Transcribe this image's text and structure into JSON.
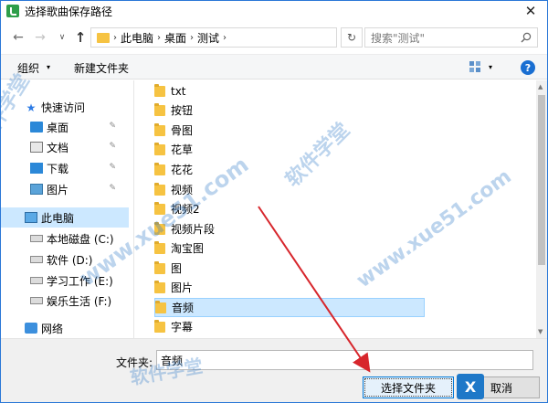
{
  "window": {
    "title": "选择歌曲保存路径",
    "close_glyph": "✕"
  },
  "nav": {
    "back": "←",
    "forward": "→",
    "recent": "∨",
    "up": "↑",
    "breadcrumbs": [
      "此电脑",
      "桌面",
      "测试"
    ],
    "dropdown": "∨",
    "refresh": "↻",
    "search_placeholder": "搜索\"测试\""
  },
  "toolbar": {
    "organize": "组织",
    "organize_arrow": "▾",
    "new_folder": "新建文件夹",
    "view_arrow": "▾",
    "help": "?"
  },
  "left_pane": {
    "items": [
      {
        "label": "快速访问",
        "icon": "star-icon",
        "pinned": false
      },
      {
        "label": "桌面",
        "icon": "desktop-icon",
        "pinned": true
      },
      {
        "label": "文档",
        "icon": "document-icon",
        "pinned": true
      },
      {
        "label": "下载",
        "icon": "download-icon",
        "pinned": true
      },
      {
        "label": "图片",
        "icon": "picture-icon",
        "pinned": true
      },
      {
        "label": "此电脑",
        "icon": "computer-icon",
        "pinned": false
      },
      {
        "label": "本地磁盘 (C:)",
        "icon": "drive-c-icon",
        "pinned": false
      },
      {
        "label": "软件 (D:)",
        "icon": "drive-icon",
        "pinned": false
      },
      {
        "label": "学习工作 (E:)",
        "icon": "drive-icon",
        "pinned": false
      },
      {
        "label": "娱乐生活 (F:)",
        "icon": "drive-icon",
        "pinned": false
      },
      {
        "label": "网络",
        "icon": "network-icon",
        "pinned": false
      }
    ],
    "pin_glyph": "✎"
  },
  "files": [
    "txt",
    "按钮",
    "骨图",
    "花草",
    "花花",
    "视频",
    "视频2",
    "视频片段",
    "淘宝图",
    "图",
    "图片",
    "音频",
    "字幕"
  ],
  "selected_file": "音频",
  "bottom": {
    "filename_label": "文件夹:",
    "filename_value": "音频",
    "select_button": "选择文件夹",
    "cancel_button": "取消"
  },
  "watermark": {
    "site": "www.xue51.com",
    "brand": "软件学堂",
    "logo_char": "X"
  },
  "colors": {
    "accent": "#0078d7",
    "selection": "#cce8ff",
    "folder": "#f6c342",
    "arrow": "#d7262c"
  }
}
